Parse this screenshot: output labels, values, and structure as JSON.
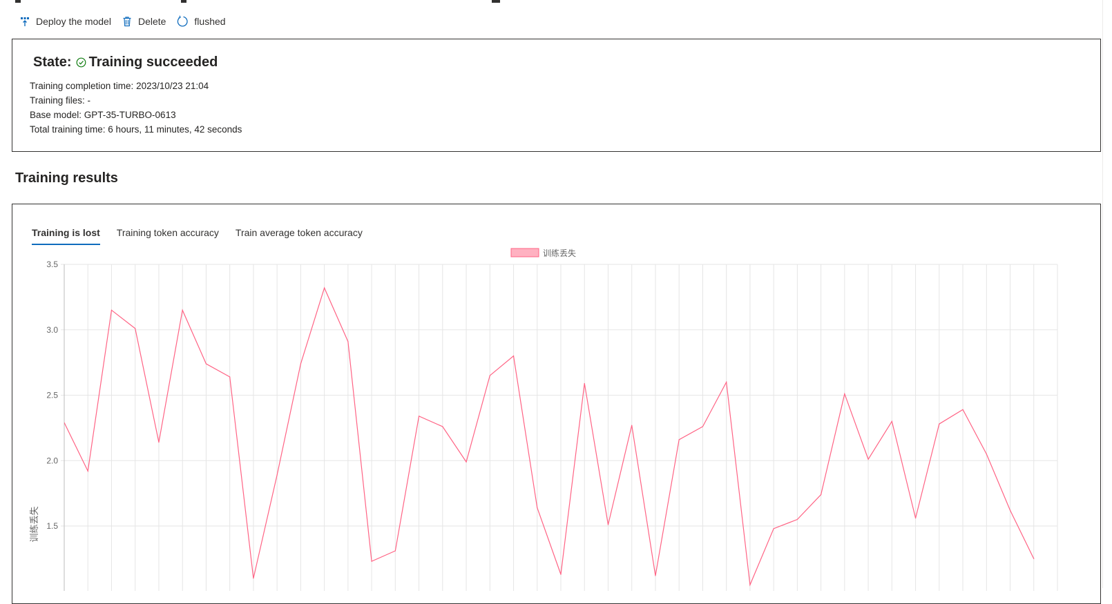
{
  "toolbar": {
    "deploy_label": "Deploy the model",
    "delete_label": "Delete",
    "refresh_label": "flushed"
  },
  "status": {
    "label": "State:",
    "value": "Training succeeded",
    "completion_time": "Training completion time: 2023/10/23 21:04",
    "training_files": "Training files: -",
    "base_model": "Base model: GPT-35-TURBO-0613",
    "total_time": "Total training time: 6 hours, 11 minutes, 42 seconds"
  },
  "results": {
    "title": "Training results",
    "tabs": [
      {
        "label": "Training is lost",
        "active": true
      },
      {
        "label": "Training token accuracy",
        "active": false
      },
      {
        "label": "Train average token accuracy",
        "active": false
      }
    ]
  },
  "colors": {
    "accent": "#0f6cbd",
    "success": "#107c10",
    "series": "#ff6384",
    "series_fill": "#ffb1c1"
  },
  "chart_data": {
    "type": "line",
    "legend": "训练丢失",
    "legend_position": "top-center",
    "ylabel": "训练丢失",
    "ylim": [
      1.15,
      3.5
    ],
    "yticks": [
      1.5,
      2.0,
      2.5,
      3.0,
      3.5
    ],
    "grid": true,
    "x": [
      1,
      2,
      3,
      4,
      5,
      6,
      7,
      8,
      9,
      10,
      11,
      12,
      13,
      14,
      15,
      16,
      17,
      18,
      19,
      20,
      21,
      22,
      23,
      24,
      25,
      26,
      27,
      28,
      29,
      30,
      31,
      32,
      33,
      34,
      35,
      36,
      37,
      38,
      39,
      40,
      41,
      42
    ],
    "series": [
      {
        "name": "训练丢失",
        "values": [
          2.29,
          1.92,
          3.15,
          3.01,
          2.14,
          3.15,
          2.74,
          2.64,
          1.1,
          1.89,
          2.74,
          3.32,
          2.91,
          1.23,
          1.31,
          2.34,
          2.26,
          1.99,
          2.65,
          2.8,
          1.64,
          1.13,
          2.59,
          1.51,
          2.27,
          1.12,
          2.16,
          2.26,
          2.6,
          1.05,
          1.48,
          1.55,
          1.74,
          2.51,
          2.01,
          2.3,
          1.56,
          2.28,
          2.39,
          2.05,
          1.62,
          1.25
        ]
      }
    ]
  }
}
